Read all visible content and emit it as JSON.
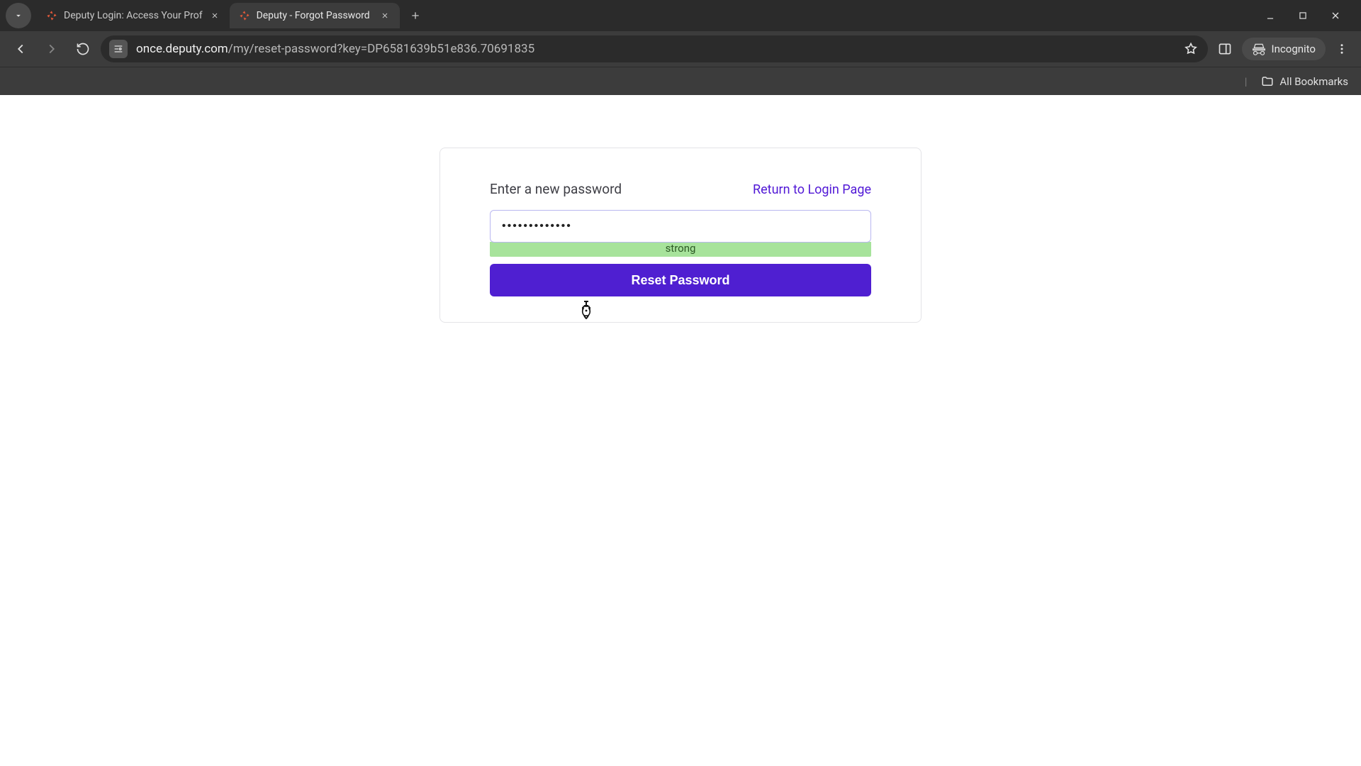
{
  "browser": {
    "tabs": [
      {
        "title": "Deputy Login: Access Your Prof",
        "active": false
      },
      {
        "title": "Deputy - Forgot Password",
        "active": true
      }
    ],
    "url_host": "once.deputy.com",
    "url_path": "/my/reset-password?key=DP6581639b51e836.70691835",
    "incognito_label": "Incognito",
    "bookmarks_label": "All Bookmarks"
  },
  "page": {
    "label": "Enter a new password",
    "return_link": "Return to Login Page",
    "password_value": "•••••••••••••",
    "strength_label": "strong",
    "reset_label": "Reset Password"
  }
}
